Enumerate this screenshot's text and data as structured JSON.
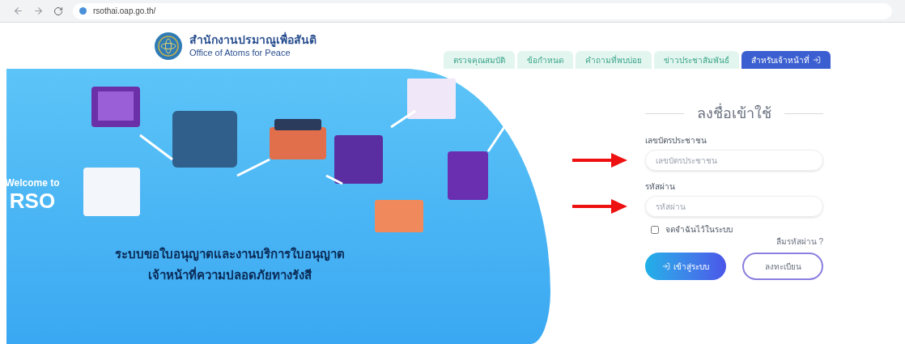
{
  "browser": {
    "url": "rsothai.oap.go.th/"
  },
  "header": {
    "title": "สำนักงานปรมาณูเพื่อสันติ",
    "subtitle": "Office of Atoms for Peace"
  },
  "tabs": [
    {
      "label": "ตรวจคุณสมบัติ",
      "selected": false
    },
    {
      "label": "ข้อกำหนด",
      "selected": false
    },
    {
      "label": "คำถามที่พบบ่อย",
      "selected": false
    },
    {
      "label": "ข่าวประชาสัมพันธ์",
      "selected": false
    },
    {
      "label": "สำหรับเจ้าหน้าที่",
      "selected": true
    }
  ],
  "banner": {
    "welcome": "Welcome to",
    "brand": "RSO",
    "headline": [
      "ระบบขอใบอนุญาตและงานบริการใบอนุญาต",
      "เจ้าหน้าที่ความปลอดภัยทางรังสี"
    ]
  },
  "login": {
    "title": "ลงชื่อเข้าใช้",
    "fields": [
      {
        "label": "เลขบัตรประชาชน",
        "placeholder": "เลขบัตรประชาชน"
      },
      {
        "label": "รหัสผ่าน",
        "placeholder": "รหัสผ่าน"
      }
    ],
    "remember": {
      "label": "จดจำฉันไว้ในระบบ",
      "checked": false
    },
    "forgot": "ลืมรหัสผ่าน ?",
    "buttons": [
      {
        "label": "เข้าสู่ระบบ",
        "kind": "primary"
      },
      {
        "label": "ลงทะเบียน",
        "kind": "outline"
      }
    ]
  }
}
